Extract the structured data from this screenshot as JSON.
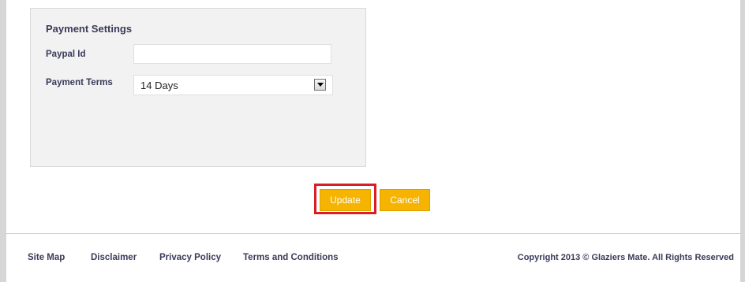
{
  "payment_settings": {
    "title": "Payment Settings",
    "paypal_label": "Paypal Id",
    "paypal_value": "",
    "terms_label": "Payment Terms",
    "terms_selected": "14 Days"
  },
  "actions": {
    "update_label": "Update",
    "cancel_label": "Cancel"
  },
  "footer": {
    "links": [
      "Site Map",
      "Disclaimer",
      "Privacy Policy",
      "Terms and Conditions"
    ],
    "copyright": "Copyright 2013 © Glaziers Mate. All Rights Reserved"
  },
  "colors": {
    "button": "#f6b400",
    "highlight": "#d81f26",
    "panel": "#f2f2f2",
    "label_text": "#3a3a5a"
  }
}
